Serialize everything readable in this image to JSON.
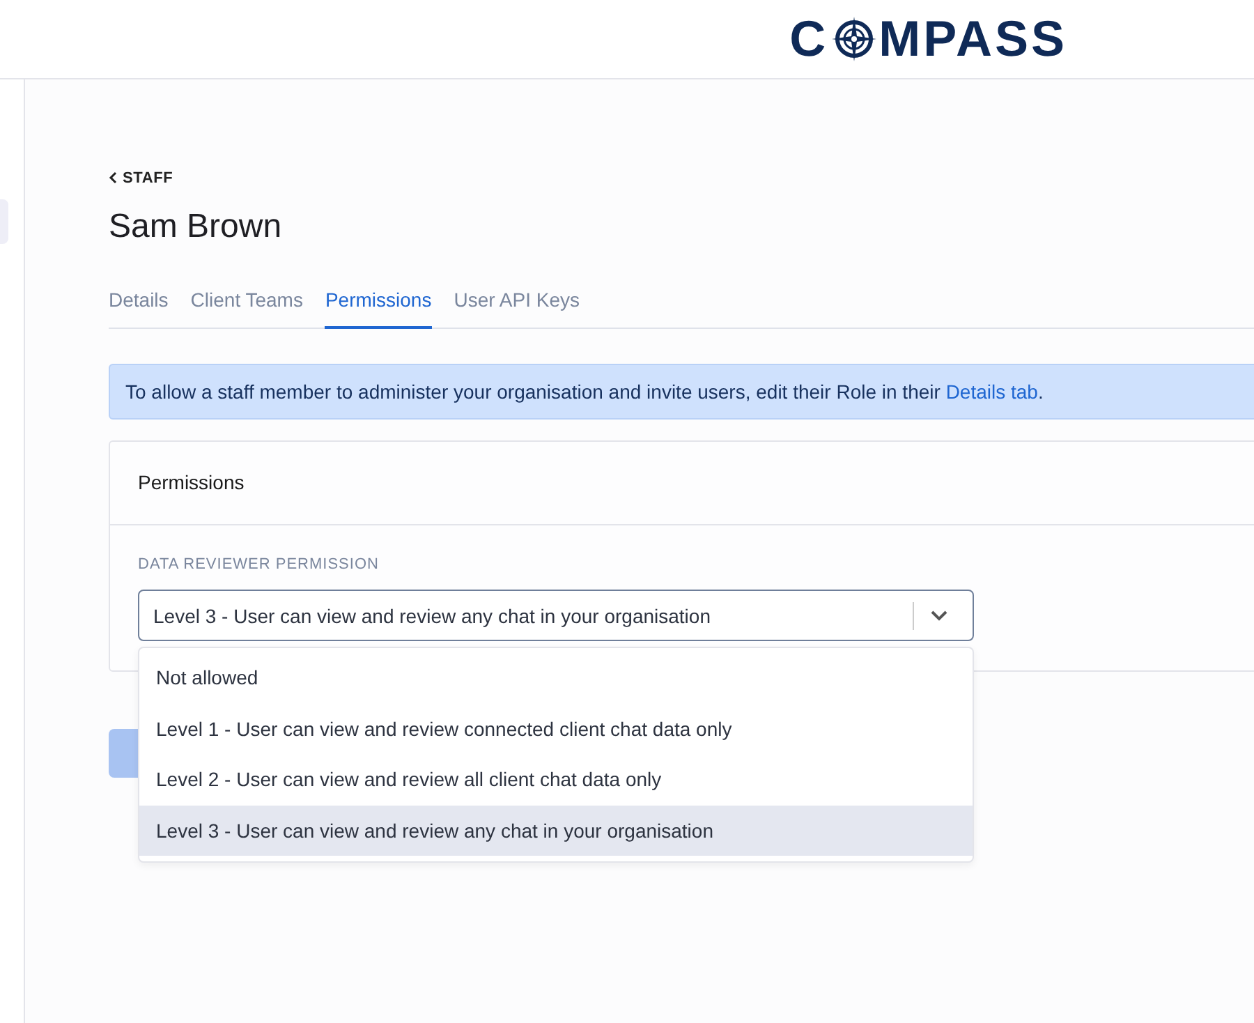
{
  "logo": {
    "before": "C",
    "after": "MPASS"
  },
  "breadcrumb": "STAFF",
  "title": "Sam Brown",
  "tabs": [
    {
      "label": "Details",
      "selected": false
    },
    {
      "label": "Client Teams",
      "selected": false
    },
    {
      "label": "Permissions",
      "selected": true
    },
    {
      "label": "User API Keys",
      "selected": false
    }
  ],
  "alert": {
    "text": "To allow a staff member to administer your organisation and invite users, edit their Role in their",
    "link": "Details tab",
    "end": "."
  },
  "card": {
    "title": "Permissions",
    "field_label": "DATA REVIEWER PERMISSION",
    "value": "Level 3 - User can view and review any chat in your organisation",
    "expanded": true,
    "options": [
      {
        "label": "Not allowed",
        "selected": false
      },
      {
        "label": "Level 1 - User can view and review connected client chat data only",
        "selected": false
      },
      {
        "label": "Level 2 - User can view and review all client chat data only",
        "selected": false
      },
      {
        "label": "Level 3 - User can view and review any chat in your organisation",
        "selected": true
      }
    ]
  }
}
